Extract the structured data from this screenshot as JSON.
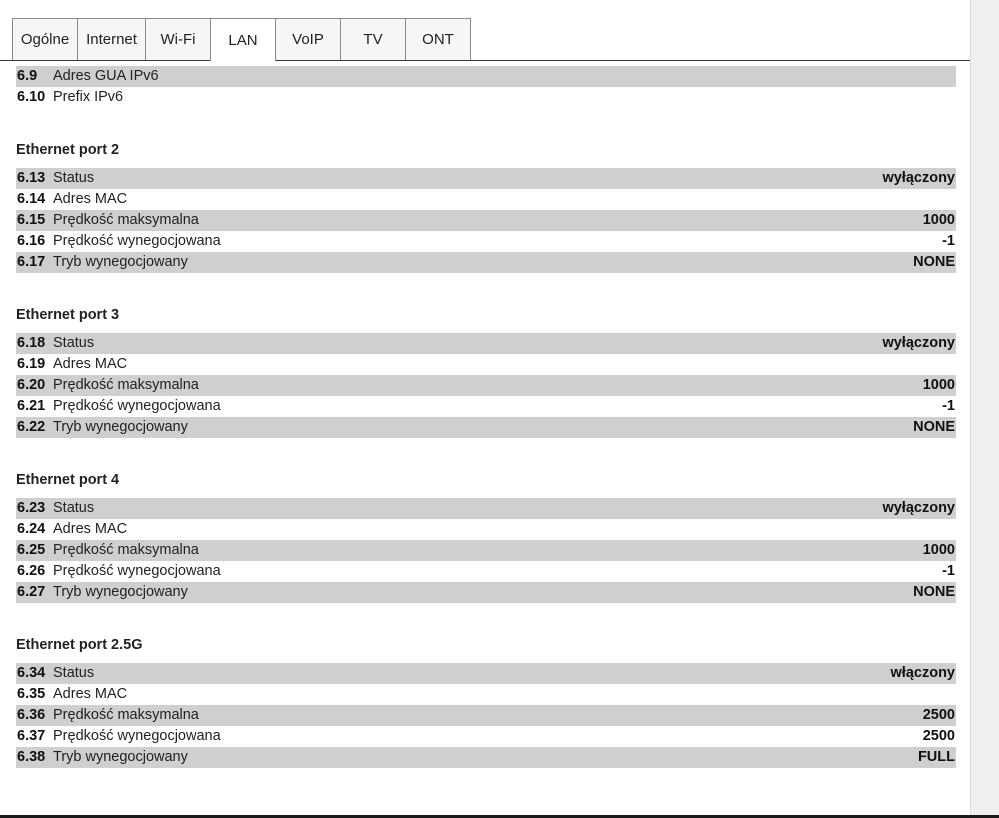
{
  "tabs": [
    {
      "label": "Ogólne",
      "width": 66
    },
    {
      "label": "Internet",
      "width": 69
    },
    {
      "label": "Wi-Fi",
      "width": 66
    },
    {
      "label": "LAN",
      "width": 66,
      "active": true
    },
    {
      "label": "VoIP",
      "width": 66
    },
    {
      "label": "TV",
      "width": 66
    },
    {
      "label": "ONT",
      "width": 66
    }
  ],
  "top_rows": [
    {
      "num": "6.9",
      "label": "Adres GUA IPv6",
      "value": "",
      "shaded": true
    },
    {
      "num": "6.10",
      "label": "Prefix IPv6",
      "value": "",
      "shaded": false
    }
  ],
  "sections": [
    {
      "title": "Ethernet port 2",
      "rows": [
        {
          "num": "6.13",
          "label": "Status",
          "value": "wyłączony",
          "shaded": true
        },
        {
          "num": "6.14",
          "label": "Adres MAC",
          "value": "",
          "shaded": false
        },
        {
          "num": "6.15",
          "label": "Prędkość maksymalna",
          "value": "1000",
          "shaded": true
        },
        {
          "num": "6.16",
          "label": "Prędkość wynegocjowana",
          "value": "-1",
          "shaded": false
        },
        {
          "num": "6.17",
          "label": "Tryb wynegocjowany",
          "value": "NONE",
          "shaded": true
        }
      ]
    },
    {
      "title": "Ethernet port 3",
      "rows": [
        {
          "num": "6.18",
          "label": "Status",
          "value": "wyłączony",
          "shaded": true
        },
        {
          "num": "6.19",
          "label": "Adres MAC",
          "value": "",
          "shaded": false
        },
        {
          "num": "6.20",
          "label": "Prędkość maksymalna",
          "value": "1000",
          "shaded": true
        },
        {
          "num": "6.21",
          "label": "Prędkość wynegocjowana",
          "value": "-1",
          "shaded": false
        },
        {
          "num": "6.22",
          "label": "Tryb wynegocjowany",
          "value": "NONE",
          "shaded": true
        }
      ]
    },
    {
      "title": "Ethernet port 4",
      "rows": [
        {
          "num": "6.23",
          "label": "Status",
          "value": "wyłączony",
          "shaded": true
        },
        {
          "num": "6.24",
          "label": "Adres MAC",
          "value": "",
          "shaded": false
        },
        {
          "num": "6.25",
          "label": "Prędkość maksymalna",
          "value": "1000",
          "shaded": true
        },
        {
          "num": "6.26",
          "label": "Prędkość wynegocjowana",
          "value": "-1",
          "shaded": false
        },
        {
          "num": "6.27",
          "label": "Tryb wynegocjowany",
          "value": "NONE",
          "shaded": true
        }
      ]
    },
    {
      "title": "Ethernet port 2.5G",
      "rows": [
        {
          "num": "6.34",
          "label": "Status",
          "value": "włączony",
          "shaded": true
        },
        {
          "num": "6.35",
          "label": "Adres MAC",
          "value": "",
          "shaded": false
        },
        {
          "num": "6.36",
          "label": "Prędkość maksymalna",
          "value": "2500",
          "shaded": true
        },
        {
          "num": "6.37",
          "label": "Prędkość wynegocjowana",
          "value": "2500",
          "shaded": false
        },
        {
          "num": "6.38",
          "label": "Tryb wynegocjowany",
          "value": "FULL",
          "shaded": true
        }
      ]
    }
  ],
  "colors": {
    "row_shade": "#cfcfcf",
    "border": "#8a8a8a"
  }
}
